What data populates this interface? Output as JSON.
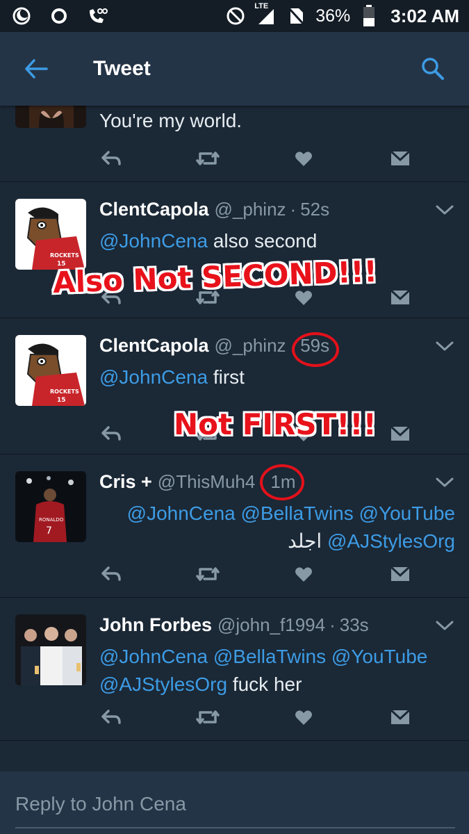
{
  "status_bar": {
    "lte": "LTE",
    "battery": "36%",
    "time": "3:02 AM"
  },
  "app_bar": {
    "title": "Tweet"
  },
  "partial_tweet": {
    "text": "You're my world."
  },
  "tweets": [
    {
      "name": "ClentCapola",
      "handle": "@_phinz",
      "time": "52s",
      "mentions": [
        "@JohnCena"
      ],
      "text": "also second",
      "overlay": "Also Not SECOND!!!"
    },
    {
      "name": "ClentCapola",
      "handle": "@_phinz",
      "time": "59s",
      "mentions": [
        "@JohnCena"
      ],
      "text": "first",
      "overlay": "Not FIRST!!!"
    },
    {
      "name": "Cris +",
      "handle": "@ThisMuh4",
      "time": "1m",
      "line1": "@JohnCena @BellaTwins @YouTube",
      "line2_mention": "@AJStylesOrg",
      "line2_text": "اجلد"
    },
    {
      "name": "John Forbes",
      "handle": "@john_f1994",
      "time": "33s",
      "line1": "@JohnCena @BellaTwins @YouTube",
      "line2_mention": "@AJStylesOrg",
      "line2_text": "fuck her"
    }
  ],
  "reply": {
    "placeholder": "Reply to John Cena"
  },
  "colors": {
    "background": "#1b2836",
    "app_bar": "#243447",
    "accent": "#3d9ce5",
    "overlay_red": "#e8121b"
  }
}
